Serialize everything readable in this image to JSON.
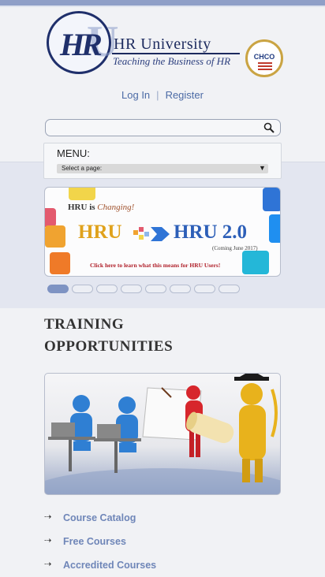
{
  "brand": {
    "logo_letters": "HR",
    "logo_watermark": "U",
    "name": "HR University",
    "tagline": "Teaching the Business of HR",
    "seal_text": "CHCO",
    "colors": {
      "navy": "#1c2a5e",
      "accent": "#8f9fc7"
    }
  },
  "auth": {
    "login": "Log In",
    "separator": "|",
    "register": "Register"
  },
  "search": {
    "placeholder": "",
    "icon": "search-icon"
  },
  "menu": {
    "label": "MENU:",
    "select_value": "Select a page:"
  },
  "banner": {
    "line1_bold": "HRU is ",
    "line1_italic": "Changing!",
    "left_logo": "HRU",
    "right_logo": "HRU 2.0",
    "coming": "(Coming June 2017)",
    "cta": "Click here to learn what this means for HRU Users!"
  },
  "carousel": {
    "slides": 8,
    "active_index": 0
  },
  "training": {
    "title_line1": "TRAINING",
    "title_line2": "OPPORTUNITIES",
    "links": [
      {
        "label": "Course Catalog"
      },
      {
        "label": "Free Courses"
      },
      {
        "label": "Accredited Courses"
      }
    ]
  }
}
